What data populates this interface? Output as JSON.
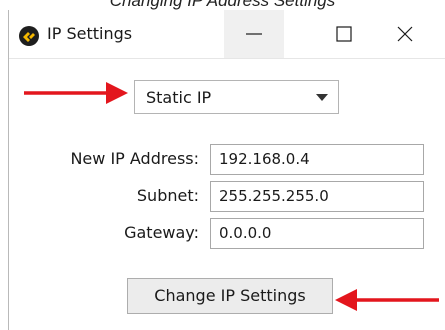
{
  "caption": "Changing IP Address Settings",
  "window": {
    "title": "IP Settings",
    "controls": {
      "minimize": "minimize",
      "maximize": "maximize",
      "close": "close"
    }
  },
  "mode_select": {
    "selected": "Static IP"
  },
  "fields": [
    {
      "label": "New IP Address:",
      "value": "192.168.0.4"
    },
    {
      "label": "Subnet:",
      "value": "255.255.255.0"
    },
    {
      "label": "Gateway:",
      "value": "0.0.0.0"
    }
  ],
  "change_button": {
    "label": "Change IP Settings"
  },
  "colors": {
    "annotation_arrow": "#e3161d",
    "app_icon_bg": "#1e1e1e",
    "app_icon_accent": "#f5b800"
  },
  "icons": {
    "app": "app-logo-icon",
    "dropdown": "chevron-down-icon"
  }
}
